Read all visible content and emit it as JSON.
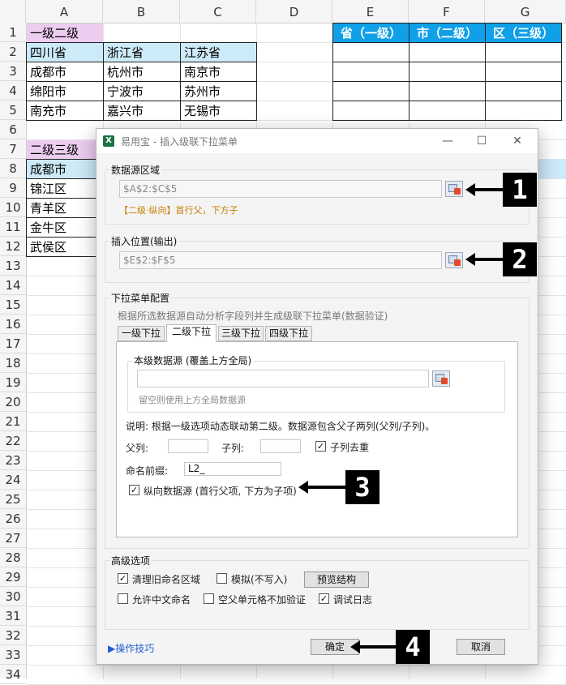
{
  "sheet": {
    "columns": [
      "A",
      "B",
      "C",
      "D",
      "E",
      "F",
      "G"
    ],
    "rows": [
      "1",
      "2",
      "3",
      "4",
      "5",
      "6",
      "7",
      "8",
      "9",
      "10",
      "11",
      "12",
      "13",
      "14",
      "15",
      "16",
      "17",
      "18",
      "19",
      "20",
      "21",
      "22",
      "23",
      "24",
      "25",
      "26",
      "27",
      "28",
      "29",
      "30",
      "31",
      "32",
      "33",
      "34"
    ],
    "table1": {
      "title": "一级二级",
      "header": [
        "四川省",
        "浙江省",
        "江苏省"
      ],
      "body": [
        [
          "成都市",
          "杭州市",
          "南京市"
        ],
        [
          "绵阳市",
          "宁波市",
          "苏州市"
        ],
        [
          "南充市",
          "嘉兴市",
          "无锡市"
        ]
      ]
    },
    "output_header": [
      "省（一级）",
      "市（二级）",
      "区（三级）"
    ],
    "table2": {
      "title": "二级三级",
      "header": "成都市",
      "body": [
        "锦江区",
        "青羊区",
        "金牛区",
        "武侯区"
      ]
    },
    "colors": {
      "pink": "#eccdf0",
      "light_blue": "#cdeaf8",
      "blue": "#0fa0e8"
    }
  },
  "dialog": {
    "title": "易用宝 - 插入级联下拉菜单",
    "app_icon": "excel-icon",
    "source_group": {
      "label": "数据源区域",
      "value": "$A$2:$C$5",
      "hint": "【二级·纵向】首行父，下方子"
    },
    "insert_group": {
      "label": "插入位置(输出)",
      "value": "$E$2:$F$5"
    },
    "config_group": {
      "label": "下拉菜单配置",
      "desc": "根据所选数据源自动分析字段列并生成级联下拉菜单(数据验证)",
      "tabs": [
        "一级下拉",
        "二级下拉",
        "三级下拉",
        "四级下拉"
      ],
      "active_tab": 1,
      "level_group_label": "本级数据源 (覆盖上方全局)",
      "level_value": "",
      "level_hint": "留空则使用上方全局数据源",
      "explain": "说明: 根据一级选项动态联动第二级。数据源包含父子两列(父列/子列)。",
      "parent_label": "父列:",
      "child_label": "子列:",
      "dedupe_label": "子列去重",
      "dedupe_checked": true,
      "prefix_label": "命名前缀:",
      "prefix_value": "L2_",
      "vertical_label": "纵向数据源 (首行父项, 下方为子项)",
      "vertical_checked": true
    },
    "advanced_group": {
      "label": "高级选项",
      "clean_label": "清理旧命名区域",
      "clean_checked": true,
      "simulate_label": "模拟(不写入)",
      "simulate_checked": false,
      "preview_label": "预览结构",
      "allow_cn_label": "允许中文命名",
      "allow_cn_checked": false,
      "empty_parent_label": "空父单元格不加验证",
      "empty_parent_checked": false,
      "debug_label": "调试日志",
      "debug_checked": true
    },
    "tips_link": "▶操作技巧",
    "ok_label": "确定",
    "cancel_label": "取消"
  },
  "markers": [
    "1",
    "2",
    "3",
    "4"
  ],
  "check_mark": "✓",
  "window_buttons": {
    "minimize": "—",
    "maximize": "☐",
    "close": "✕"
  },
  "xl_glyph": "X"
}
